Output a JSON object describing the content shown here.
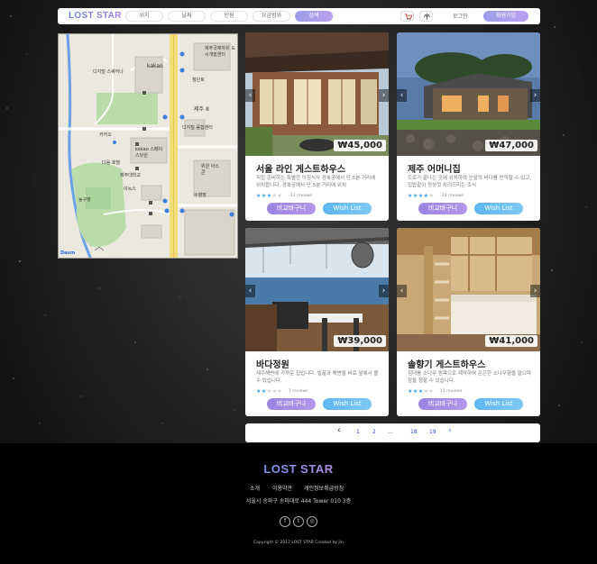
{
  "brand": {
    "logo": "LOST STAR",
    "accent_gradient": [
      "#6b7fd8",
      "#a07fe0"
    ]
  },
  "nav": {
    "tabs": [
      {
        "label": "위치"
      },
      {
        "label": "날짜"
      },
      {
        "label": "인원"
      },
      {
        "label": "요금범위"
      },
      {
        "label": "검색"
      }
    ],
    "icons": [
      "cart-icon",
      "compare-icon"
    ],
    "login": "로그인",
    "signup": "회원가입"
  },
  "map": {
    "labels": [
      "kakao",
      "디지털 스퀘어나",
      "제주국제자유 도시개발센터",
      "첨단로",
      "제주 8",
      "디지털 융합센터",
      "kakao 스페이스닷원",
      "카카오",
      "다음 호텔",
      "제주대학교",
      "이녹스",
      "농구장",
      "위원 아스콘",
      "수영장",
      "Daum"
    ]
  },
  "listings": [
    {
      "title": "서울 라인 게스트하우스",
      "price": "₩45,000",
      "description": "직접 준비하는 특별한 아침식사 경복궁에서 단 5분 거리에 위치합니다. 경복궁에서 단 5분 거리에 위치",
      "rating": 3,
      "reviews": "12 reviews",
      "compare_label": "비교바구니",
      "wish_label": "Wish List"
    },
    {
      "title": "제주 어머니집",
      "price": "₩47,000",
      "description": "도로가 끝나는 곳에 위치하여 눈앞의 바다를 만끽할 수 있고, 집밥같이 정성껏 차려드리는 조식",
      "rating": 4,
      "reviews": "24 reviews",
      "compare_label": "비교바구니",
      "wish_label": "Wish List"
    },
    {
      "title": "바다정원",
      "price": "₩39,000",
      "description": "제주해변에 가까운 집입니다. 벌꿀과 해변을 바로 앞에서 볼 수 있습니다.",
      "rating": 2,
      "reviews": "7 reviews",
      "compare_label": "비교바구니",
      "wish_label": "Wish List"
    },
    {
      "title": "솔향기 게스트하우스",
      "price": "₩41,000",
      "description": "침대를 소나무 원목으로 제작하여 은은한 소나무향을 맡으며 잠을 청할 수 있습니다.",
      "rating": 3,
      "reviews": "11 reviews",
      "compare_label": "비교바구니",
      "wish_label": "Wish List"
    }
  ],
  "pagination": {
    "prev": "‹",
    "pages": [
      "1",
      "2",
      "…",
      "18",
      "19"
    ],
    "next": "›"
  },
  "footer": {
    "logo": "LOST STAR",
    "links": [
      "소개",
      "이용약관",
      "개인정보취급방침"
    ],
    "address": "서울시 송파구 송파대로 444 Tower 010 3층",
    "social": [
      "facebook-icon",
      "twitter-icon",
      "instagram-icon"
    ],
    "copyright": "Copyright © 2017 LOST STAR Created by Jin"
  }
}
